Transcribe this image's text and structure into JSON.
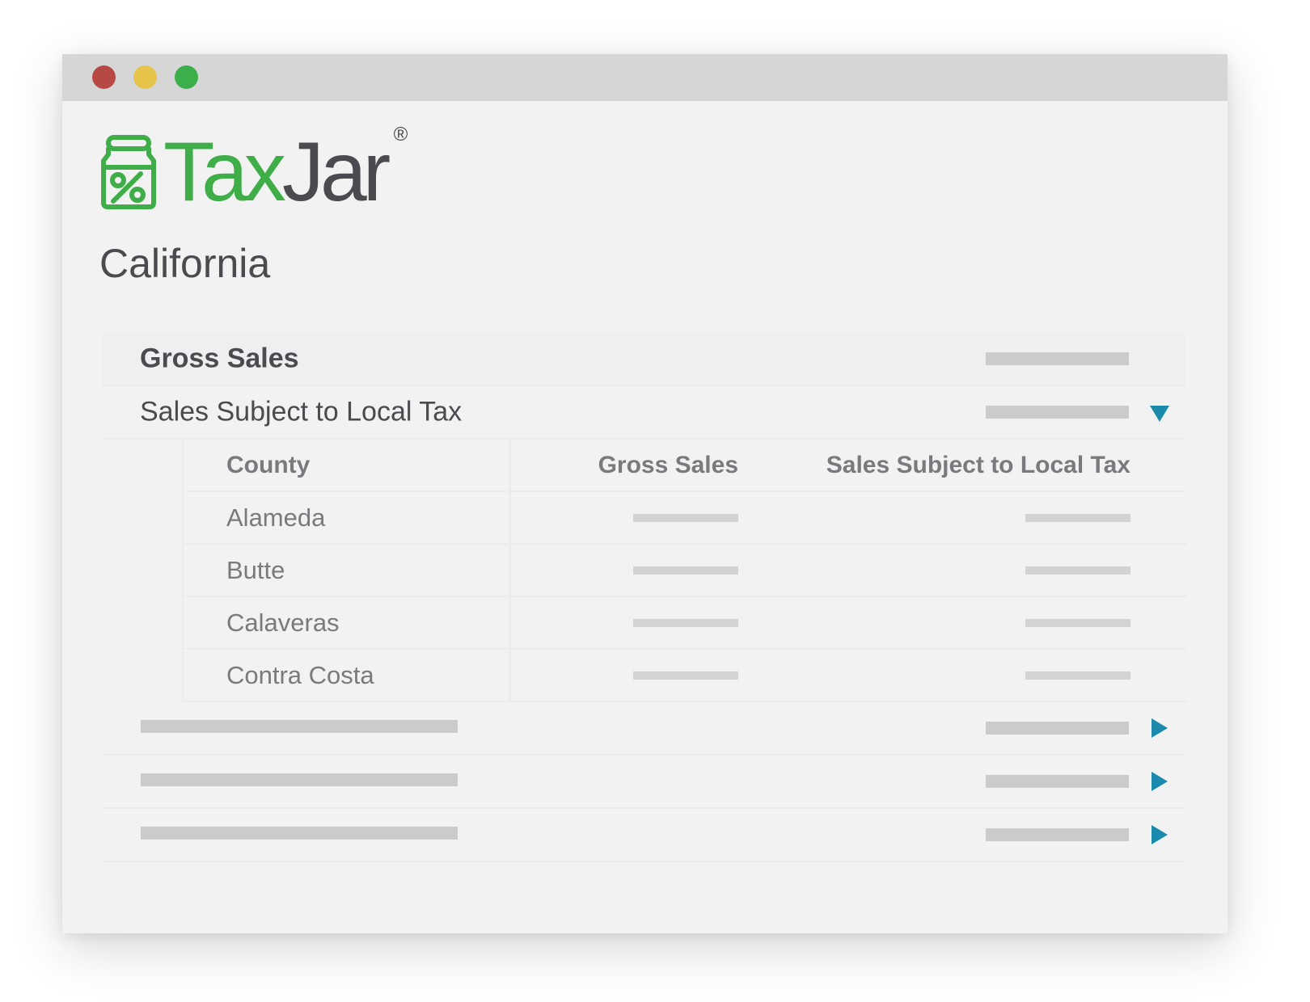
{
  "window": {
    "traffic_lights": [
      "close",
      "minimize",
      "maximize"
    ],
    "colors": {
      "close": "#b84843",
      "minimize": "#e6c449",
      "maximize": "#3bb04a"
    }
  },
  "brand": {
    "name_part1": "Tax",
    "name_part2": "Jar",
    "registered_mark": "®",
    "colors": {
      "green": "#3fae49",
      "dark": "#4a4a4f"
    },
    "icon": "jar-percent-icon"
  },
  "page_title": "California",
  "summary_rows": [
    {
      "label": "Gross Sales",
      "expanded": null
    },
    {
      "label": "Sales Subject to Local Tax",
      "expanded": true
    }
  ],
  "county_table": {
    "headers": {
      "county": "County",
      "gross_sales": "Gross Sales",
      "local_tax": "Sales Subject to Local Tax"
    },
    "rows": [
      {
        "county": "Alameda"
      },
      {
        "county": "Butte"
      },
      {
        "county": "Calaveras"
      },
      {
        "county": "Contra Costa"
      }
    ]
  },
  "collapsed_rows": [
    {
      "expanded": false
    },
    {
      "expanded": false
    },
    {
      "expanded": false
    }
  ],
  "accent_color": "#1b8aad"
}
